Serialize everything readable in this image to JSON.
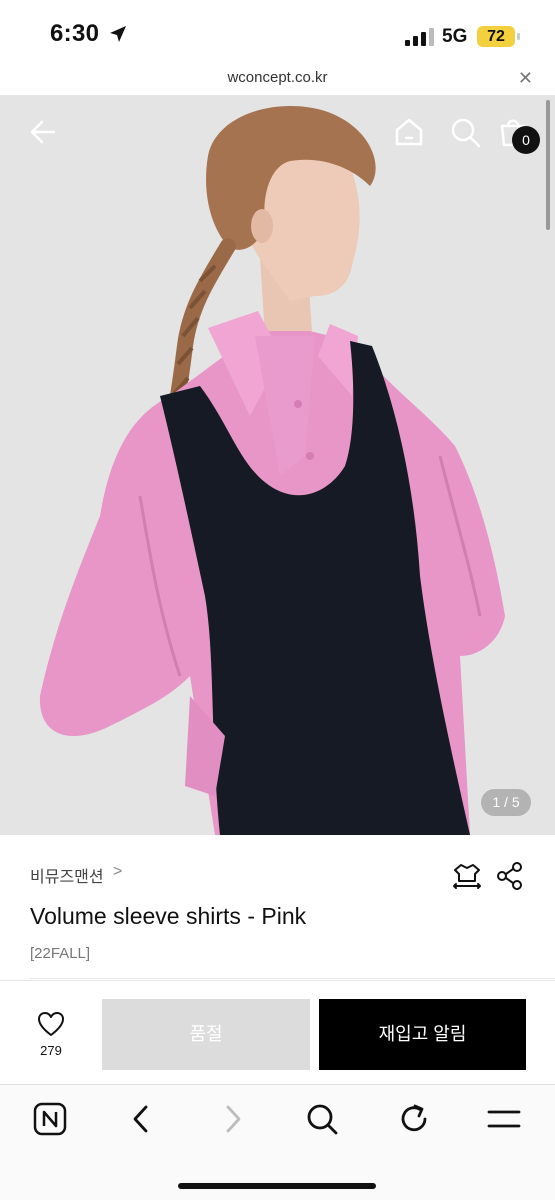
{
  "status_bar": {
    "time": "6:30",
    "network": "5G",
    "battery": "72",
    "battery_color": "#f3d03e"
  },
  "browser": {
    "url": "wconcept.co.kr",
    "close_icon": "close-icon"
  },
  "hero": {
    "back_icon": "back-arrow-icon",
    "home_icon": "home-icon",
    "search_icon": "search-icon",
    "cart_icon": "shopping-bag-icon",
    "cart_count": "0",
    "page_indicator": "1 / 5"
  },
  "product": {
    "brand": "비뮤즈맨션",
    "brand_chevron": ">",
    "title": "Volume sleeve shirts - Pink",
    "tag": "[22FALL]",
    "size_icon": "size-guide-icon",
    "share_icon": "share-icon"
  },
  "actions": {
    "like_icon": "heart-icon",
    "like_count": "279",
    "soldout_label": "품절",
    "restock_label": "재입고 알림",
    "soldout_color": "#dcdcdc",
    "restock_color": "#000000"
  },
  "browser_toolbar": {
    "items": [
      "naver-icon",
      "back-icon",
      "forward-icon",
      "search-icon",
      "refresh-icon",
      "menu-icon"
    ]
  }
}
